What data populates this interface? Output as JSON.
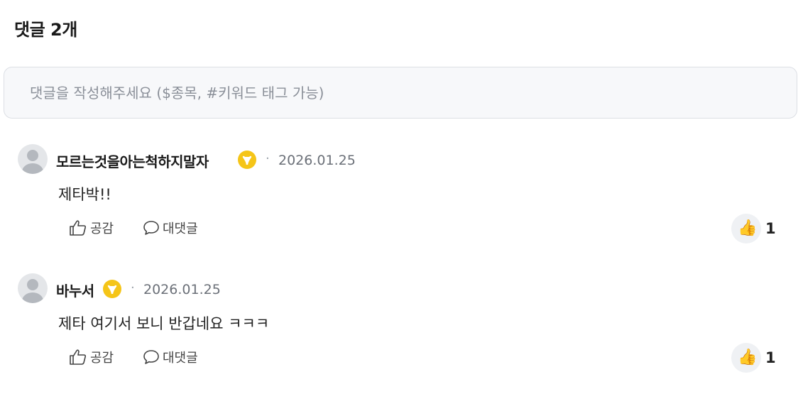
{
  "header": {
    "title": "댓글 2개"
  },
  "input": {
    "placeholder": "댓글을 작성해주세요 ($종목, #키워드 태그 가능)"
  },
  "comments": [
    {
      "author": "모르는것을아는척하지말자",
      "separator": "·",
      "date": "2026.01.25",
      "text": "제타박!!",
      "like_label": "공감",
      "reply_label": "대댓글",
      "reaction_emoji": "👍",
      "reaction_count": "1"
    },
    {
      "author": "바누서",
      "separator": "·",
      "date": "2026.01.25",
      "text": "제타 여기서 보니 반갑네요 ㅋㅋㅋ",
      "like_label": "공감",
      "reply_label": "대댓글",
      "reaction_emoji": "👍",
      "reaction_count": "1"
    }
  ],
  "icons": {
    "badge": "gold-leaf-badge-icon",
    "like": "thumbs-up-outline-icon",
    "reply": "speech-bubble-icon",
    "reaction": "thumbs-up-emoji"
  },
  "colors": {
    "badge": "#f5c518",
    "muted": "#6b7078",
    "input_bg": "#f7f8fa"
  }
}
